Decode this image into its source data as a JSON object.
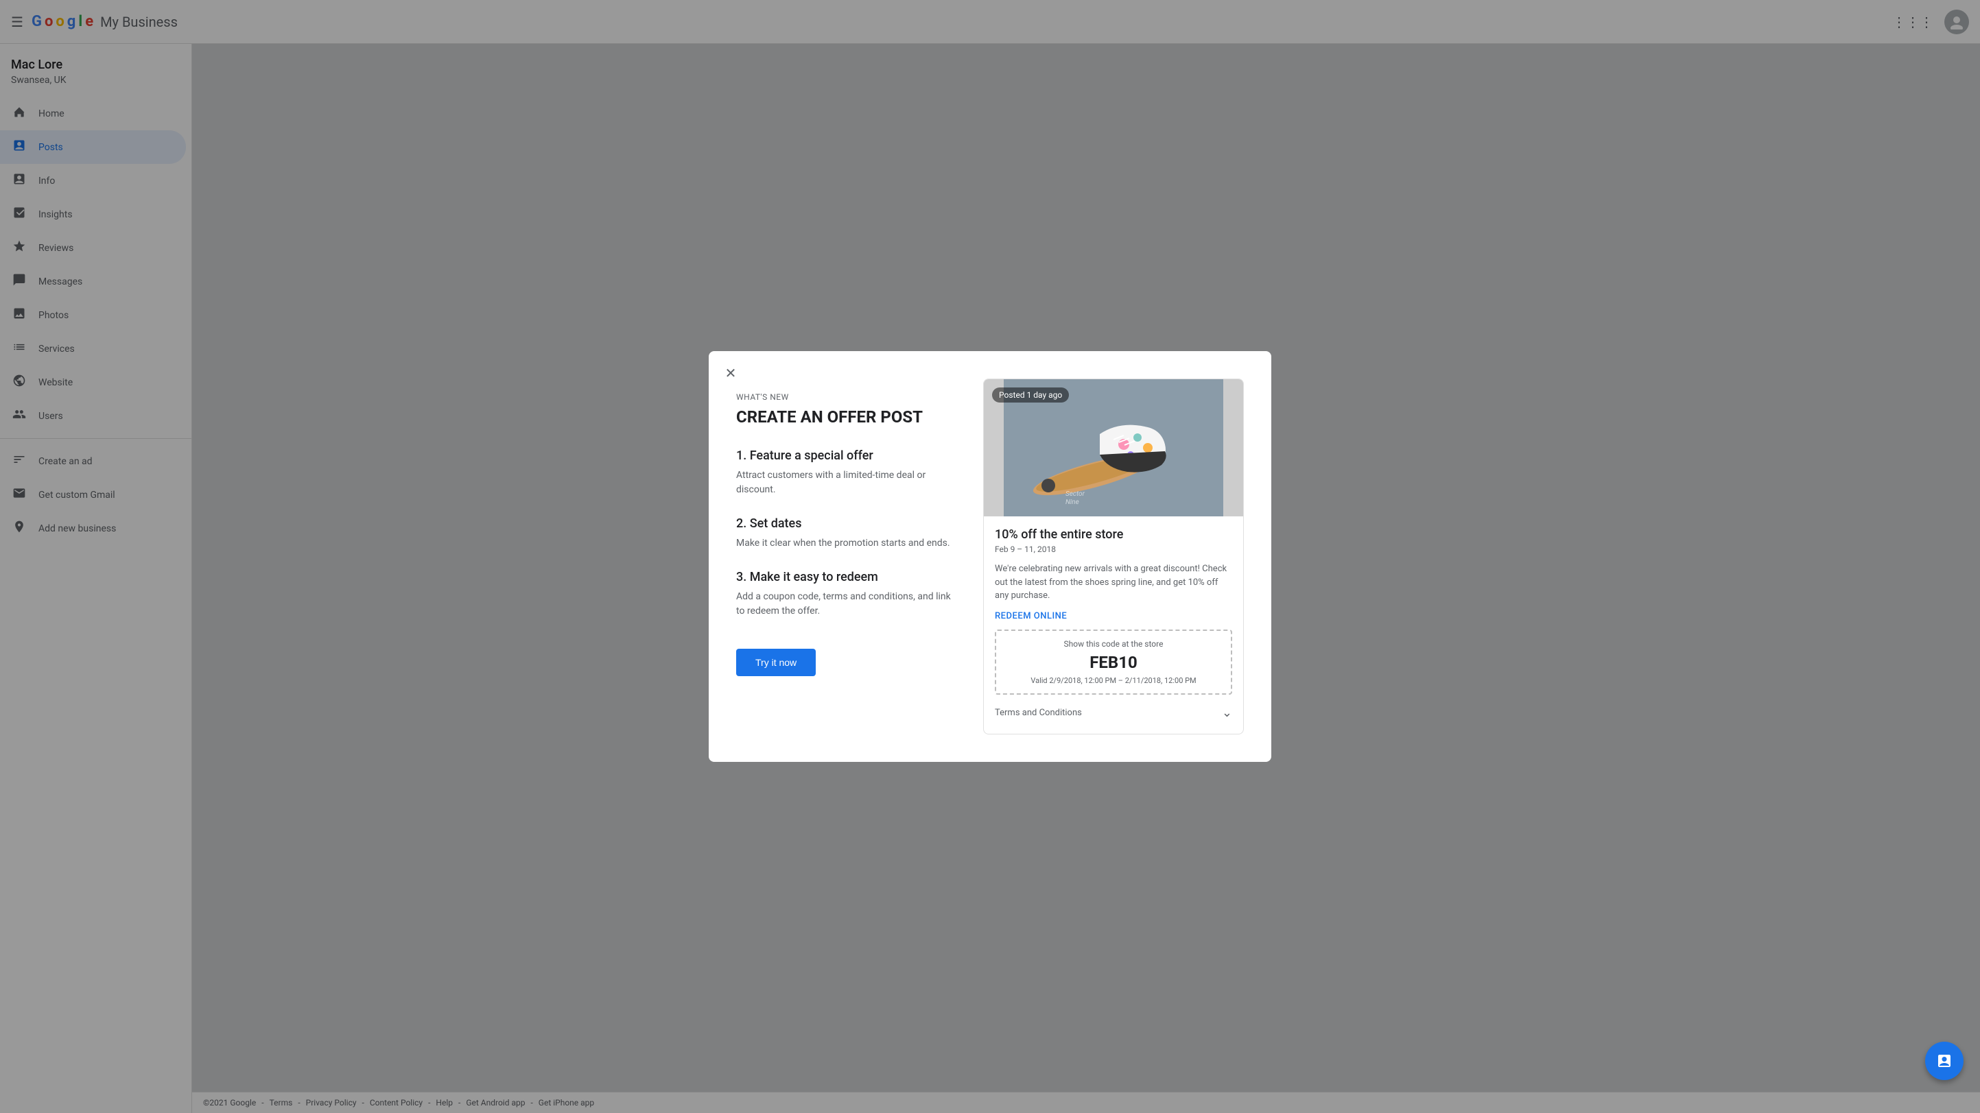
{
  "app": {
    "logo_letters": [
      "G",
      "o",
      "o",
      "g",
      "l",
      "e"
    ],
    "logo_colors": [
      "#4285f4",
      "#ea4335",
      "#fbbc04",
      "#4285f4",
      "#34a853",
      "#ea4335"
    ],
    "title": "My Business"
  },
  "topbar": {
    "menu_icon": "☰",
    "grid_icon": "⊞"
  },
  "sidebar": {
    "business_name": "Mac Lore",
    "business_location": "Swansea, UK",
    "items": [
      {
        "id": "home",
        "label": "Home",
        "icon": "⊞"
      },
      {
        "id": "posts",
        "label": "Posts",
        "icon": "▦",
        "active": true
      },
      {
        "id": "info",
        "label": "Info",
        "icon": "☰"
      },
      {
        "id": "insights",
        "label": "Insights",
        "icon": "📊"
      },
      {
        "id": "reviews",
        "label": "Reviews",
        "icon": "★"
      },
      {
        "id": "messages",
        "label": "Messages",
        "icon": "💬"
      },
      {
        "id": "photos",
        "label": "Photos",
        "icon": "🖼"
      },
      {
        "id": "services",
        "label": "Services",
        "icon": "☰"
      },
      {
        "id": "website",
        "label": "Website",
        "icon": "🌐"
      },
      {
        "id": "users",
        "label": "Users",
        "icon": "👤"
      }
    ],
    "bottom_items": [
      {
        "id": "create-ad",
        "label": "Create an ad",
        "icon": "▲"
      },
      {
        "id": "custom-gmail",
        "label": "Get custom Gmail",
        "icon": "✉"
      },
      {
        "id": "add-business",
        "label": "Add new business",
        "icon": "📍"
      }
    ]
  },
  "modal": {
    "close_icon": "✕",
    "whats_new": "What's new",
    "title": "CREATE AN OFFER POST",
    "steps": [
      {
        "heading": "1. Feature a special offer",
        "description": "Attract customers with a limited-time deal or discount."
      },
      {
        "heading": "2. Set dates",
        "description": "Make it clear when the promotion starts and ends."
      },
      {
        "heading": "3. Make it easy to redeem",
        "description": "Add a coupon code, terms and conditions, and link to redeem the offer."
      }
    ],
    "try_button": "Try it now",
    "preview": {
      "posted_label": "Posted 1 day ago",
      "offer_title": "10% off the entire store",
      "dates": "Feb 9 – 11, 2018",
      "description": "We're celebrating new arrivals with a great discount! Check out the latest from the shoes spring line, and get 10% off any purchase.",
      "redeem_link": "REDEEM ONLINE",
      "coupon": {
        "show_text": "Show this code at the store",
        "code": "FEB10",
        "valid_text": "Valid 2/9/2018, 12:00 PM – 2/11/2018, 12:00 PM"
      },
      "terms_label": "Terms and Conditions"
    }
  },
  "footer": {
    "copyright": "©2021 Google",
    "links": [
      "Terms",
      "Privacy Policy",
      "Content Policy",
      "Help",
      "Get Android app",
      "Get iPhone app"
    ]
  },
  "fab": {
    "icon": "☰"
  }
}
